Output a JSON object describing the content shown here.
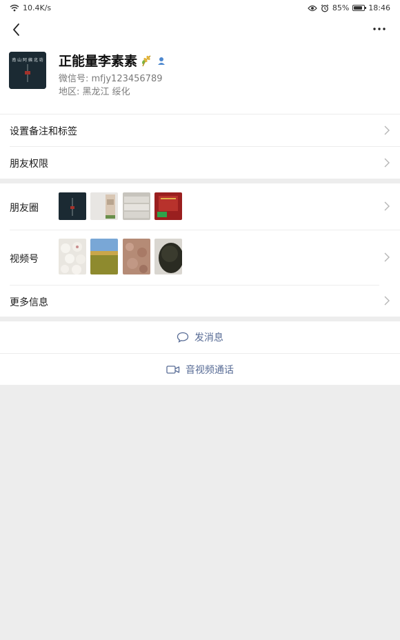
{
  "status_bar": {
    "network_speed": "10.4K/s",
    "battery": "85%",
    "time": "18:46",
    "battery_level": 0.85
  },
  "profile": {
    "name": "正能量李素素",
    "wechat_id": "微信号: mfjy123456789",
    "region": "地区: 黑龙江  绥化",
    "avatar_text": "南山阿姨北坊"
  },
  "menu": {
    "remark_tags": "设置备注和标签",
    "friend_permissions": "朋友权限",
    "moments": "朋友圈",
    "channels": "视频号",
    "more_info": "更多信息"
  },
  "actions": {
    "send_message": "发消息",
    "video_call": "音视频通话"
  },
  "colors": {
    "link": "#576b95",
    "background": "#ededed"
  }
}
